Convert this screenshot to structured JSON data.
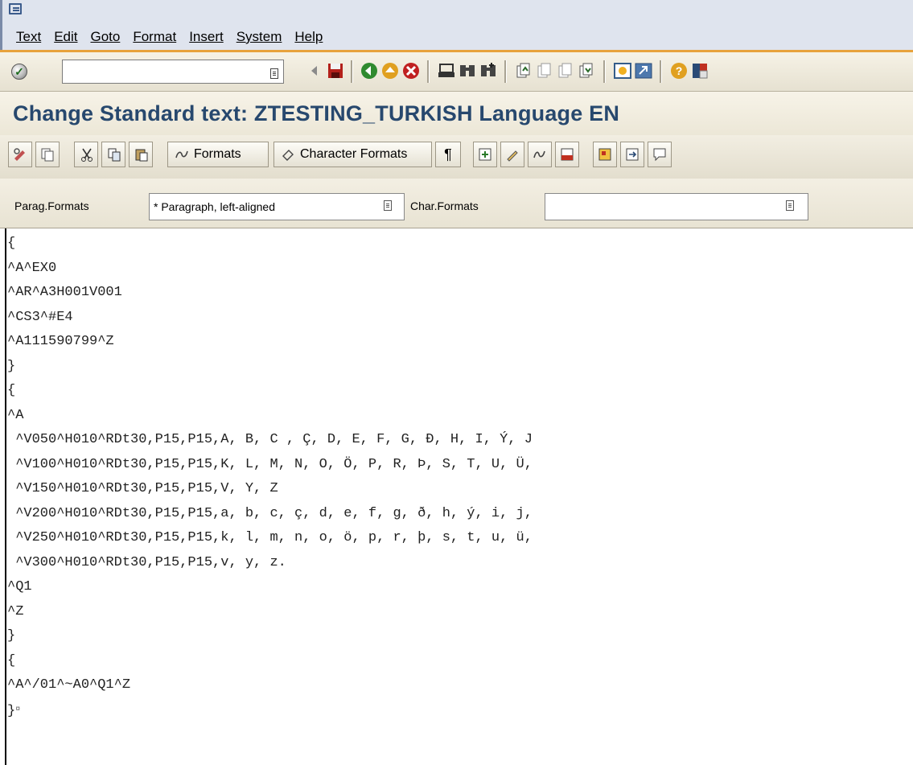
{
  "menu": [
    "Text",
    "Edit",
    "Goto",
    "Format",
    "Insert",
    "System",
    "Help"
  ],
  "menu_underline_index": [
    0,
    0,
    0,
    1,
    0,
    1,
    0
  ],
  "toolbar": {
    "command_field_value": "",
    "icons": [
      "enter-icon",
      "back-arrow-icon",
      "save-icon",
      "back-icon",
      "exit-icon",
      "cancel-icon",
      "print-icon",
      "find-icon",
      "find-next-icon",
      "first-page-icon",
      "previous-page-icon",
      "next-page-icon",
      "last-page-icon",
      "create-session-icon",
      "shortcut-icon",
      "help-icon",
      "layout-menu-icon"
    ]
  },
  "title": "Change Standard text: ZTESTING_TURKISH Language EN",
  "app_toolbar": {
    "formats_label": "Formats",
    "character_formats_label": "Character Formats",
    "paragraph_symbol": "¶"
  },
  "format_line": {
    "parag_label": "Parag.Formats",
    "parag_value": "* Paragraph, left-aligned",
    "char_label": "Char.Formats",
    "char_value": ""
  },
  "editor_lines": [
    "{",
    "^A^EX0",
    "^AR^A3H001V001",
    "^CS3^#E4",
    "^A111590799^Z",
    "}",
    "{",
    "^A",
    " ^V050^H010^RDt30,P15,P15,A, B, C , Ç, D, E, F, G, Ð, H, I, Ý, J",
    " ^V100^H010^RDt30,P15,P15,K, L, M, N, O, Ö, P, R, Þ, S, T, U, Ü,",
    " ^V150^H010^RDt30,P15,P15,V, Y, Z",
    " ^V200^H010^RDt30,P15,P15,a, b, c, ç, d, e, f, g, ð, h, ý, i, j,",
    " ^V250^H010^RDt30,P15,P15,k, l, m, n, o, ö, p, r, þ, s, t, u, ü,",
    " ^V300^H010^RDt30,P15,P15,v, y, z.",
    "^Q1",
    "^Z",
    "}",
    "{",
    "^A^/01^~A0^Q1^Z",
    "}"
  ],
  "end_mark": "¤",
  "colors": {
    "title": "#27486e",
    "menubar_bg": "#dfe4ee",
    "toolbar_accent": "#e8a23c"
  }
}
